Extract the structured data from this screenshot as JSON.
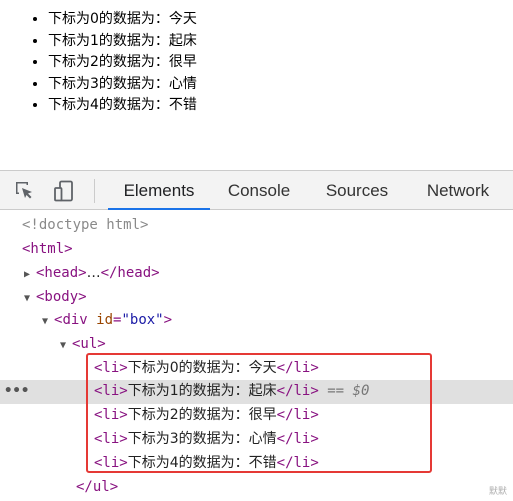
{
  "page": {
    "items": [
      "下标为0的数据为：今天",
      "下标为1的数据为：起床",
      "下标为2的数据为：很早",
      "下标为3的数据为：心情",
      "下标为4的数据为：不错"
    ]
  },
  "devtools": {
    "icons": [
      "inspect-element-icon",
      "device-toolbar-icon"
    ],
    "tabs": [
      "Elements",
      "Console",
      "Sources",
      "Network"
    ],
    "active_tab": "Elements",
    "tree": {
      "doctype": "<!doctype html>",
      "html_open": "<html>",
      "head_open": "<head>",
      "ellipsis": "…",
      "head_close": "</head>",
      "body_open": "<body>",
      "div_tag": "div",
      "div_attr_name": "id",
      "div_attr_value": "\"box\"",
      "ul_open": "<ul>",
      "li_open": "<li>",
      "li_close": "</li>",
      "li_texts": [
        "下标为0的数据为：今天",
        "下标为1的数据为：起床",
        "下标为2的数据为：很早",
        "下标为3的数据为：心情",
        "下标为4的数据为：不错"
      ],
      "selected_marker": "== $0",
      "ul_close": "</ul>",
      "dots": "•••"
    },
    "highlight_color": "#e53935",
    "accent_color": "#1a73e8"
  },
  "watermark": "默默"
}
